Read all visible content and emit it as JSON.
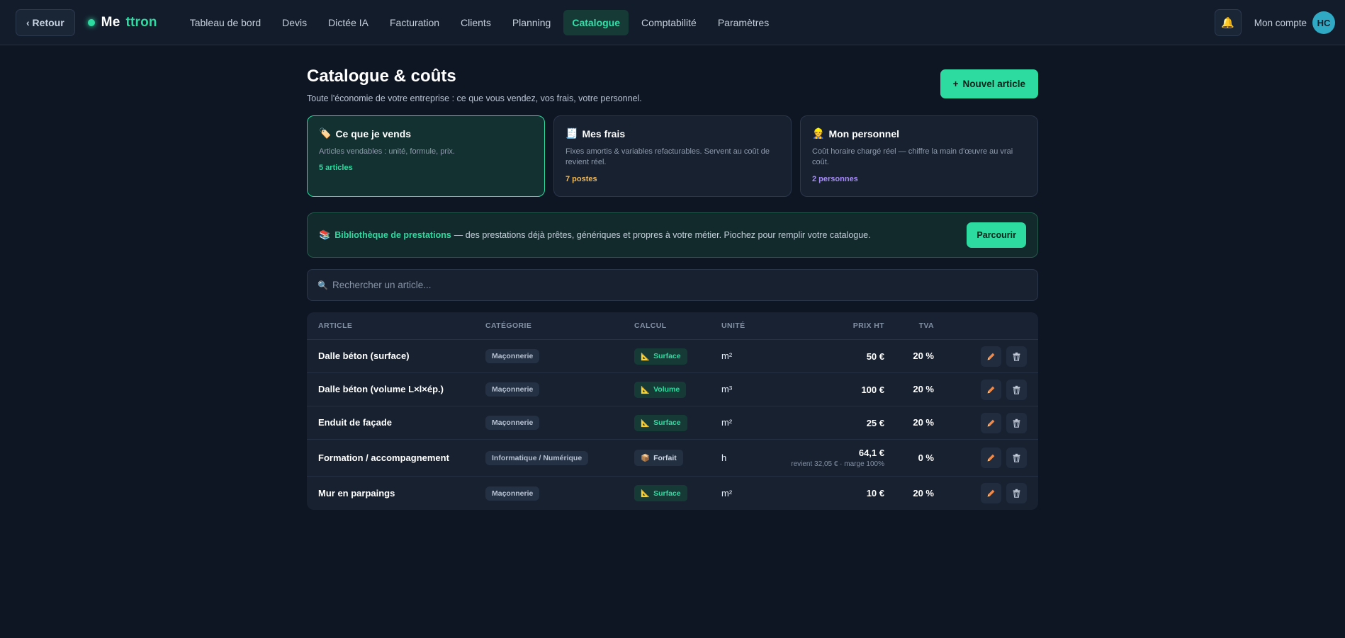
{
  "topbar": {
    "back_label": "‹ Retour",
    "brand_part1": "Me",
    "brand_part2": "ttron",
    "nav": [
      {
        "label": "Tableau de bord"
      },
      {
        "label": "Devis"
      },
      {
        "label": "Dictée IA"
      },
      {
        "label": "Facturation"
      },
      {
        "label": "Clients"
      },
      {
        "label": "Planning"
      },
      {
        "label": "Catalogue",
        "active": true
      },
      {
        "label": "Comptabilité"
      },
      {
        "label": "Paramètres"
      }
    ],
    "account_label": "Mon compte",
    "avatar_initials": "HC",
    "bell_icon": "bell-icon"
  },
  "header": {
    "title": "Catalogue & coûts",
    "subtitle": "Toute l'économie de votre entreprise : ce que vous vendez, vos frais, votre personnel.",
    "new_button_label": "Nouvel article",
    "new_button_icon": "+"
  },
  "cards": [
    {
      "icon": "🏷️",
      "title": "Ce que je vends",
      "desc": "Articles vendables : unité, formule, prix.",
      "count": "5 articles",
      "count_color": "#2ddba0",
      "active": true
    },
    {
      "icon": "🧾",
      "title": "Mes frais",
      "desc": "Fixes amortis & variables refacturables. Servent au coût de revient réel.",
      "count": "7 postes",
      "count_color": "#f0b95a",
      "active": false
    },
    {
      "icon": "👷",
      "title": "Mon personnel",
      "desc": "Coût horaire chargé réel — chiffre la main d'œuvre au vrai coût.",
      "count": "2 personnes",
      "count_color": "#a78bfa",
      "active": false
    }
  ],
  "library": {
    "icon": "📚",
    "title": "Bibliothèque de prestations",
    "text": "— des prestations déjà prêtes, génériques et propres à votre métier. Piochez pour remplir votre catalogue.",
    "button_label": "Parcourir"
  },
  "search": {
    "icon": "🔍",
    "placeholder": "Rechercher un article..."
  },
  "table": {
    "columns": {
      "article": "Article",
      "category": "Catégorie",
      "calc": "Calcul",
      "unit": "Unité",
      "price": "Prix HT",
      "tva": "TVA"
    },
    "rows": [
      {
        "article": "Dalle béton (surface)",
        "category": "Maçonnerie",
        "calc_icon": "📐",
        "calc": "Surface",
        "unit": "m²",
        "price": "50 €",
        "price_sub": "",
        "tva": "20 %"
      },
      {
        "article": "Dalle béton (volume L×l×ép.)",
        "category": "Maçonnerie",
        "calc_icon": "📐",
        "calc": "Volume",
        "unit": "m³",
        "price": "100 €",
        "price_sub": "",
        "tva": "20 %"
      },
      {
        "article": "Enduit de façade",
        "category": "Maçonnerie",
        "calc_icon": "📐",
        "calc": "Surface",
        "unit": "m²",
        "price": "25 €",
        "price_sub": "",
        "tva": "20 %"
      },
      {
        "article": "Formation / accompagnement",
        "category": "Informatique / Numérique",
        "calc_icon": "📦",
        "calc": "Forfait",
        "unit": "h",
        "price": "64,1 €",
        "price_sub": "revient 32,05 € · marge 100%",
        "tva": "0 %"
      },
      {
        "article": "Mur en parpaings",
        "category": "Maçonnerie",
        "calc_icon": "📐",
        "calc": "Surface",
        "unit": "m²",
        "price": "10 €",
        "price_sub": "",
        "tva": "20 %"
      }
    ]
  },
  "colors": {
    "accent": "#2ddba0",
    "background": "#0e1624",
    "card": "#172130",
    "edit_icon": "#f08a4b"
  }
}
